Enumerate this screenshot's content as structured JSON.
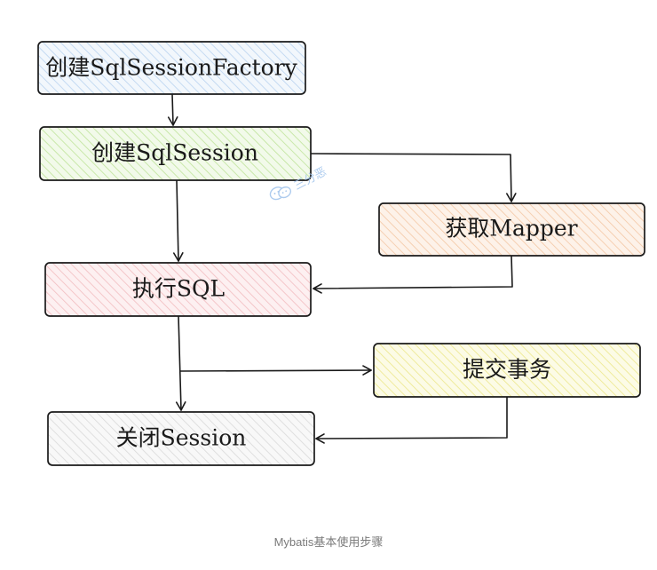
{
  "diagram": {
    "nodes": [
      {
        "id": "create-factory",
        "label": "创建SqlSessionFactory",
        "fill": "#dbe9f8"
      },
      {
        "id": "create-session",
        "label": "创建SqlSession",
        "fill": "#d3efb7"
      },
      {
        "id": "get-mapper",
        "label": "获取Mapper",
        "fill": "#fbdcc2"
      },
      {
        "id": "execute-sql",
        "label": "执行SQL",
        "fill": "#f9d2d4"
      },
      {
        "id": "commit-tx",
        "label": "提交事务",
        "fill": "#f6f3b6"
      },
      {
        "id": "close-session",
        "label": "关闭Session",
        "fill": "#e6e6e6"
      }
    ],
    "edges": [
      {
        "from": "create-factory",
        "to": "create-session"
      },
      {
        "from": "create-session",
        "to": "execute-sql"
      },
      {
        "from": "create-session",
        "to": "get-mapper"
      },
      {
        "from": "get-mapper",
        "to": "execute-sql"
      },
      {
        "from": "execute-sql",
        "to": "close-session"
      },
      {
        "from": "execute-sql",
        "to": "commit-tx"
      },
      {
        "from": "commit-tx",
        "to": "close-session"
      }
    ]
  },
  "watermark": {
    "text": "三分恶"
  },
  "caption": "Mybatis基本使用步骤",
  "colors": {
    "stroke": "#1a1a1a",
    "watermark": "#9fc3ec"
  }
}
